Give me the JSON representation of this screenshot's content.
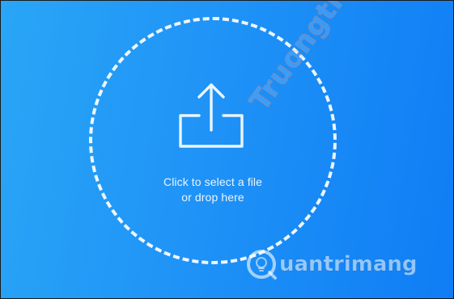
{
  "upload": {
    "line1": "Click to select a file",
    "line2": "or drop here",
    "icon": "upload-icon"
  },
  "watermark": {
    "site_text": "Truongtin.top",
    "brand_text": "uantrimang",
    "brand_icon": "quantrimang-logo-icon"
  },
  "colors": {
    "background_start": "#29a6f6",
    "background_end": "#0f7df5",
    "foreground": "#ffffff"
  }
}
